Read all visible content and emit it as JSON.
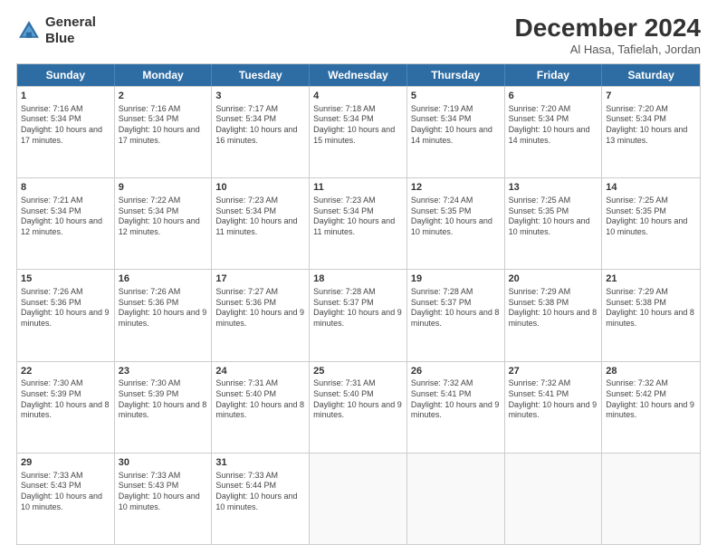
{
  "logo": {
    "line1": "General",
    "line2": "Blue"
  },
  "title": "December 2024",
  "subtitle": "Al Hasa, Tafielah, Jordan",
  "days": [
    "Sunday",
    "Monday",
    "Tuesday",
    "Wednesday",
    "Thursday",
    "Friday",
    "Saturday"
  ],
  "weeks": [
    [
      {
        "day": "1",
        "sunrise": "7:16 AM",
        "sunset": "5:34 PM",
        "daylight": "10 hours and 17 minutes."
      },
      {
        "day": "2",
        "sunrise": "7:16 AM",
        "sunset": "5:34 PM",
        "daylight": "10 hours and 17 minutes."
      },
      {
        "day": "3",
        "sunrise": "7:17 AM",
        "sunset": "5:34 PM",
        "daylight": "10 hours and 16 minutes."
      },
      {
        "day": "4",
        "sunrise": "7:18 AM",
        "sunset": "5:34 PM",
        "daylight": "10 hours and 15 minutes."
      },
      {
        "day": "5",
        "sunrise": "7:19 AM",
        "sunset": "5:34 PM",
        "daylight": "10 hours and 14 minutes."
      },
      {
        "day": "6",
        "sunrise": "7:20 AM",
        "sunset": "5:34 PM",
        "daylight": "10 hours and 14 minutes."
      },
      {
        "day": "7",
        "sunrise": "7:20 AM",
        "sunset": "5:34 PM",
        "daylight": "10 hours and 13 minutes."
      }
    ],
    [
      {
        "day": "8",
        "sunrise": "7:21 AM",
        "sunset": "5:34 PM",
        "daylight": "10 hours and 12 minutes."
      },
      {
        "day": "9",
        "sunrise": "7:22 AM",
        "sunset": "5:34 PM",
        "daylight": "10 hours and 12 minutes."
      },
      {
        "day": "10",
        "sunrise": "7:23 AM",
        "sunset": "5:34 PM",
        "daylight": "10 hours and 11 minutes."
      },
      {
        "day": "11",
        "sunrise": "7:23 AM",
        "sunset": "5:34 PM",
        "daylight": "10 hours and 11 minutes."
      },
      {
        "day": "12",
        "sunrise": "7:24 AM",
        "sunset": "5:35 PM",
        "daylight": "10 hours and 10 minutes."
      },
      {
        "day": "13",
        "sunrise": "7:25 AM",
        "sunset": "5:35 PM",
        "daylight": "10 hours and 10 minutes."
      },
      {
        "day": "14",
        "sunrise": "7:25 AM",
        "sunset": "5:35 PM",
        "daylight": "10 hours and 10 minutes."
      }
    ],
    [
      {
        "day": "15",
        "sunrise": "7:26 AM",
        "sunset": "5:36 PM",
        "daylight": "10 hours and 9 minutes."
      },
      {
        "day": "16",
        "sunrise": "7:26 AM",
        "sunset": "5:36 PM",
        "daylight": "10 hours and 9 minutes."
      },
      {
        "day": "17",
        "sunrise": "7:27 AM",
        "sunset": "5:36 PM",
        "daylight": "10 hours and 9 minutes."
      },
      {
        "day": "18",
        "sunrise": "7:28 AM",
        "sunset": "5:37 PM",
        "daylight": "10 hours and 9 minutes."
      },
      {
        "day": "19",
        "sunrise": "7:28 AM",
        "sunset": "5:37 PM",
        "daylight": "10 hours and 8 minutes."
      },
      {
        "day": "20",
        "sunrise": "7:29 AM",
        "sunset": "5:38 PM",
        "daylight": "10 hours and 8 minutes."
      },
      {
        "day": "21",
        "sunrise": "7:29 AM",
        "sunset": "5:38 PM",
        "daylight": "10 hours and 8 minutes."
      }
    ],
    [
      {
        "day": "22",
        "sunrise": "7:30 AM",
        "sunset": "5:39 PM",
        "daylight": "10 hours and 8 minutes."
      },
      {
        "day": "23",
        "sunrise": "7:30 AM",
        "sunset": "5:39 PM",
        "daylight": "10 hours and 8 minutes."
      },
      {
        "day": "24",
        "sunrise": "7:31 AM",
        "sunset": "5:40 PM",
        "daylight": "10 hours and 8 minutes."
      },
      {
        "day": "25",
        "sunrise": "7:31 AM",
        "sunset": "5:40 PM",
        "daylight": "10 hours and 9 minutes."
      },
      {
        "day": "26",
        "sunrise": "7:32 AM",
        "sunset": "5:41 PM",
        "daylight": "10 hours and 9 minutes."
      },
      {
        "day": "27",
        "sunrise": "7:32 AM",
        "sunset": "5:41 PM",
        "daylight": "10 hours and 9 minutes."
      },
      {
        "day": "28",
        "sunrise": "7:32 AM",
        "sunset": "5:42 PM",
        "daylight": "10 hours and 9 minutes."
      }
    ],
    [
      {
        "day": "29",
        "sunrise": "7:33 AM",
        "sunset": "5:43 PM",
        "daylight": "10 hours and 10 minutes."
      },
      {
        "day": "30",
        "sunrise": "7:33 AM",
        "sunset": "5:43 PM",
        "daylight": "10 hours and 10 minutes."
      },
      {
        "day": "31",
        "sunrise": "7:33 AM",
        "sunset": "5:44 PM",
        "daylight": "10 hours and 10 minutes."
      },
      null,
      null,
      null,
      null
    ]
  ]
}
